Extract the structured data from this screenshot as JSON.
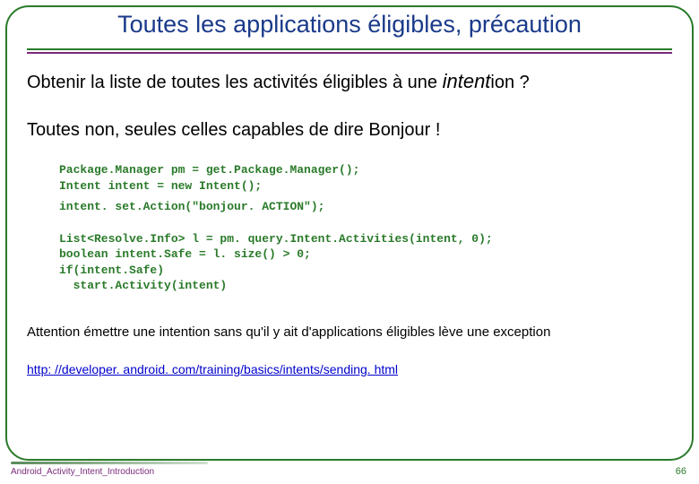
{
  "title": "Toutes les applications éligibles, précaution",
  "line1_prefix": "Obtenir la liste de toutes les activités éligibles à une ",
  "line1_intent_word": "intent",
  "line1_suffix": "ion ?",
  "line2": "Toutes non, seules celles capables de dire Bonjour !",
  "code_block1": "Package.Manager pm = get.Package.Manager();\nIntent intent = new Intent();",
  "code_block2": "intent. set.Action(\"bonjour. ACTION\");",
  "code_block3": "List<Resolve.Info> l = pm. query.Intent.Activities(intent, 0);\nboolean intent.Safe = l. size() > 0;\nif(intent.Safe)\n  start.Activity(intent)",
  "warning": "Attention émettre une intention sans qu'il y ait d'applications éligibles lève une exception",
  "link_text": "http: //developer. android. com/training/basics/intents/sending. html",
  "footer_left": "Android_Activity_Intent_Introduction",
  "page_number": "66"
}
